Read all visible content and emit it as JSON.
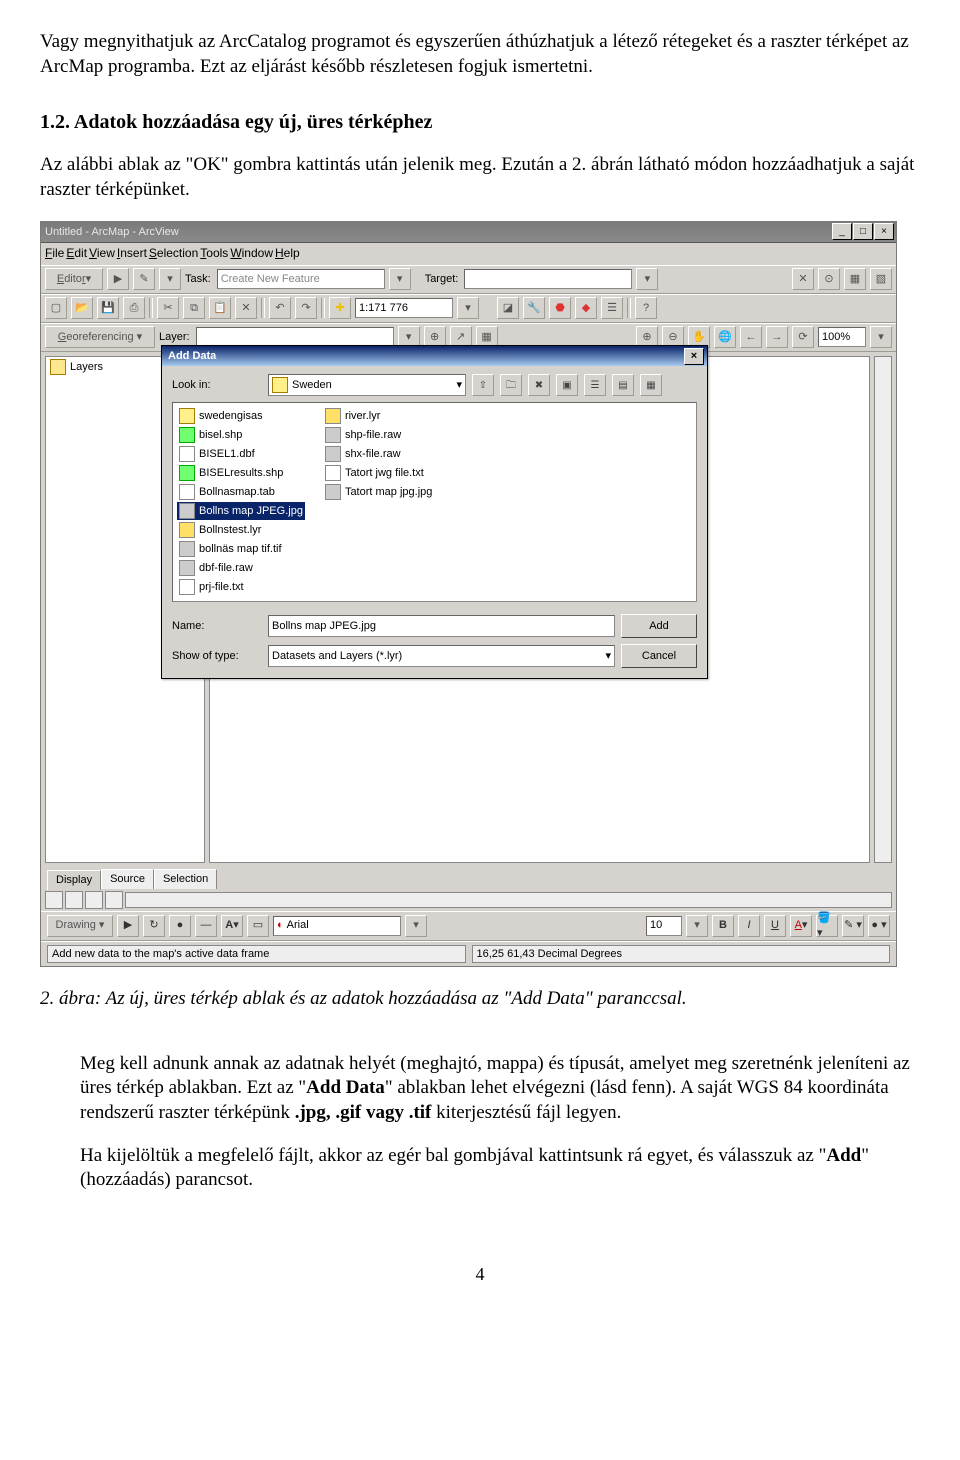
{
  "doc": {
    "intro": "Vagy megnyithatjuk az ArcCatalog programot és egyszerűen áthúzhatjuk a létező rétegeket és a raszter térképet az ArcMap programba.  Ezt az eljárást később részletesen fogjuk ismertetni.",
    "section_title": "1.2. Adatok hozzáadása egy új, üres térképhez",
    "section_intro": "Az alábbi ablak az \"OK\" gombra kattintás után jelenik meg.  Ezután a 2. ábrán látható módon hozzáadhatjuk a saját raszter térképünket.",
    "caption": "2. ábra:  Az új, üres térkép ablak és az adatok hozzáadása az \"Add Data\" paranccsal.",
    "para2": "Meg kell adnunk annak az adatnak helyét (meghajtó, mappa) és típusát, amelyet meg szeretnénk jeleníteni az üres térkép ablakban.  Ezt az \"Add Data\" ablakban lehet elvégezni (lásd fenn).  A saját WGS 84 koordináta rendszerű raszter térképünk .jpg, .gif vagy .tif kiterjesztésű fájl legyen.",
    "para3": "Ha kijelöltük a megfelelő fájlt, akkor az egér bal gombjával kattintsunk rá egyet, és válasszuk az \"Add\" (hozzáadás) parancsot.",
    "page_number": "4"
  },
  "app": {
    "title": "Untitled - ArcMap - ArcView",
    "menu": [
      "File",
      "Edit",
      "View",
      "Insert",
      "Selection",
      "Tools",
      "Window",
      "Help"
    ],
    "editor_row": {
      "editor": "Editor ▾",
      "task_label": "Task:",
      "task_value": "Create New Feature",
      "target_label": "Target:"
    },
    "main_row": {
      "scale": "1:171 776"
    },
    "georef_row": {
      "georef": "Georeferencing ▾",
      "layer_label": "Layer:",
      "pct": "100%"
    },
    "toc_root": "Layers",
    "add_data": {
      "title": "Add Data",
      "lookin_label": "Look in:",
      "lookin_value": "Sweden",
      "name_label": "Name:",
      "name_value": "Bollns map JPEG.jpg",
      "type_label": "Show of type:",
      "type_value": "Datasets and Layers (*.lyr)",
      "add_btn": "Add",
      "cancel_btn": "Cancel",
      "files_col1": [
        {
          "ico": "folder",
          "name": "swedengisas"
        },
        {
          "ico": "shp",
          "name": "bisel.shp"
        },
        {
          "ico": "dbf",
          "name": "BISEL1.dbf"
        },
        {
          "ico": "shp",
          "name": "BISELresults.shp"
        },
        {
          "ico": "tab",
          "name": "Bollnasmap.tab"
        },
        {
          "ico": "img",
          "name": "Bollns map JPEG.jpg",
          "selected": true
        },
        {
          "ico": "lyr",
          "name": "Bollnstest.lyr"
        },
        {
          "ico": "tif",
          "name": "bollnäs map tif.tif"
        },
        {
          "ico": "raw",
          "name": "dbf-file.raw"
        }
      ],
      "files_col2": [
        {
          "ico": "txt",
          "name": "prj-file.txt"
        },
        {
          "ico": "lyr",
          "name": "river.lyr"
        },
        {
          "ico": "raw",
          "name": "shp-file.raw"
        },
        {
          "ico": "raw",
          "name": "shx-file.raw"
        },
        {
          "ico": "txt",
          "name": "Tatort jwg file.txt"
        },
        {
          "ico": "img",
          "name": "Tatort map jpg.jpg"
        }
      ]
    },
    "bottom_tabs": [
      "Display",
      "Source",
      "Selection"
    ],
    "drawing_row": {
      "drawing": "Drawing ▾",
      "font": "Arial",
      "size": "10"
    },
    "status": {
      "msg": "Add new data to the map's active data frame",
      "coords": "16,25  61,43 Decimal Degrees"
    }
  }
}
